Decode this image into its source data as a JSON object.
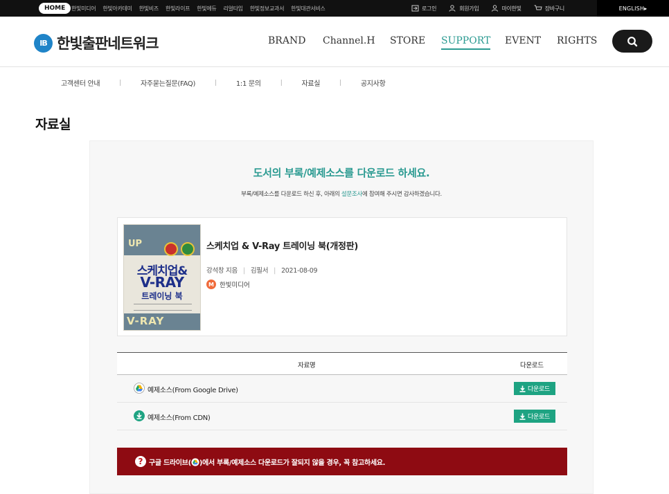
{
  "topbar": {
    "home": "HOME",
    "links": [
      "한빛미디어",
      "한빛아카데미",
      "한빛비즈",
      "한빛라이프",
      "한빛에듀",
      "리얼타임",
      "한빛정보교과서",
      "한빛대관서비스"
    ],
    "right": {
      "login": "로그인",
      "signup": "회원가입",
      "mypage": "마이한빛",
      "cart": "장바구니"
    },
    "english": "ENGLISH▸"
  },
  "header": {
    "logo_badge": "IB",
    "logo_text": "한빛출판네트워크",
    "nav": [
      "BRAND",
      "Channel.H",
      "STORE",
      "SUPPORT",
      "EVENT",
      "RIGHTS"
    ],
    "active_nav": "SUPPORT"
  },
  "subnav": [
    "고객센터 안내",
    "자주묻는질문(FAQ)",
    "1:1 문의",
    "자료실",
    "공지사항"
  ],
  "page_title": "자료실",
  "panel": {
    "headline": "도서의 부록/예제소스를 다운로드 하세요.",
    "subline_before": "부록/예제소스를 다운로드 하신 후, 아래의 ",
    "subline_link": "설문조사",
    "subline_after": "에 참여해 주시면 감사하겠습니다."
  },
  "book": {
    "title": "스케치업 & V-Ray 트레이닝 북(개정판)",
    "author": "강석창 지음",
    "format": "김필서",
    "date": "2021-08-09",
    "publisher": "한빛미디어",
    "publisher_badge": "M",
    "cover": {
      "line1": "스케치업&",
      "line2": "V-RAY",
      "line3": "트레이닝 북",
      "top_text": "UP",
      "bottom_text": "V-RAY"
    }
  },
  "table": {
    "col_name": "자료명",
    "col_download": "다운로드",
    "rows": [
      {
        "name": "예제소스(From Google Drive)",
        "icon": "google-drive-icon",
        "button": "다운로드"
      },
      {
        "name": "예제소스(From CDN)",
        "icon": "cdn-download-icon",
        "button": "다운로드"
      }
    ]
  },
  "notice": {
    "before": "구글 드라이브(",
    "after": ")에서 부록/예제소스 다운로드가 잘되지 않을 경우, 꼭 참고하세요."
  },
  "colors": {
    "accent": "#2a9a91",
    "download_button": "#1ea382",
    "notice_bg": "#8e0b12",
    "logo_blue": "#1f84c8"
  }
}
